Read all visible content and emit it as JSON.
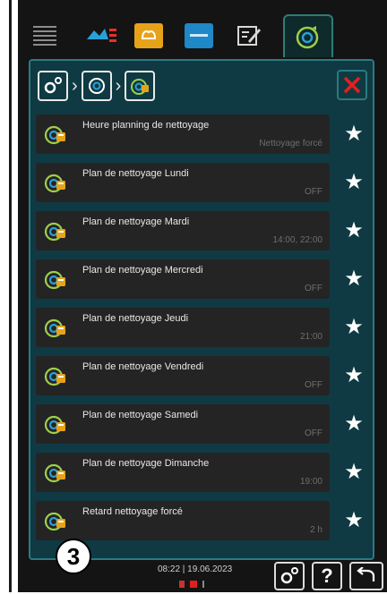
{
  "rows": [
    {
      "label": "Heure planning de nettoyage",
      "value": "Nettoyage forcé"
    },
    {
      "label": "Plan de nettoyage Lundi",
      "value": "OFF"
    },
    {
      "label": "Plan de nettoyage Mardi",
      "value": "14:00, 22:00"
    },
    {
      "label": "Plan de nettoyage Mercredi",
      "value": "OFF"
    },
    {
      "label": "Plan de nettoyage Jeudi",
      "value": "21:00"
    },
    {
      "label": "Plan de nettoyage Vendredi",
      "value": "OFF"
    },
    {
      "label": "Plan de nettoyage Samedi",
      "value": "OFF"
    },
    {
      "label": "Plan de nettoyage Dimanche",
      "value": "19:00"
    },
    {
      "label": "Retard nettoyage forcé",
      "value": "2 h"
    }
  ],
  "footer": {
    "datetime": "08:22 | 19.06.2023",
    "step_badge": "3",
    "help_label": "?"
  },
  "colors": {
    "panel_bg": "#0f3a43",
    "accent": "#2b7a80",
    "close_red": "#e02020",
    "row_bg": "#242424"
  },
  "icons": {
    "tabs": [
      "menu-icon",
      "people-icon",
      "oven-icon",
      "tray-icon",
      "edit-icon",
      "cleaning-schedule-icon"
    ],
    "breadcrumb": [
      "settings-icon",
      "cleaning-icon",
      "cleaning-schedule-icon"
    ],
    "rows": "cleaning-schedule-icon",
    "footer": [
      "settings-icon",
      "help-icon",
      "back-icon"
    ]
  }
}
